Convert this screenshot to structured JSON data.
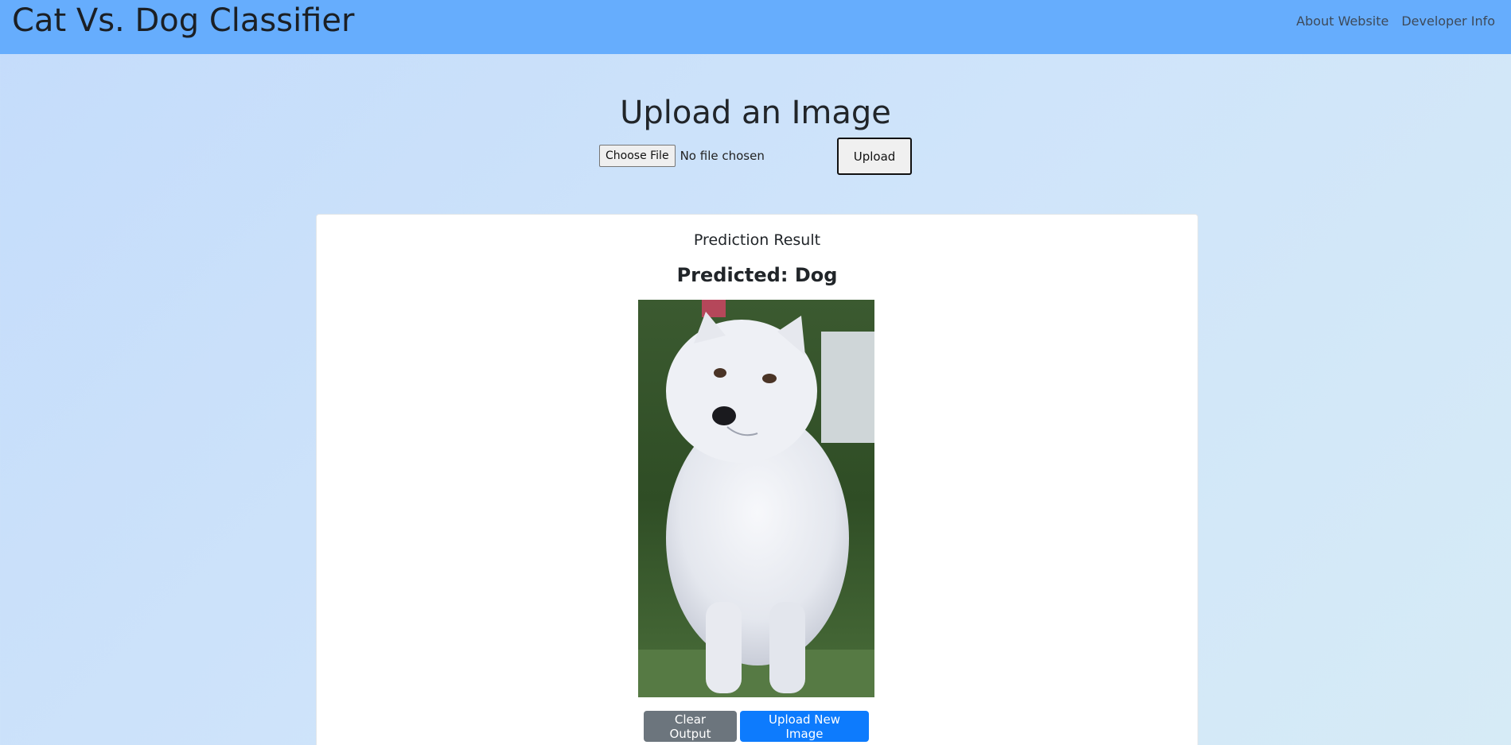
{
  "navbar": {
    "brand": "Cat Vs. Dog Classifier",
    "links": [
      {
        "label": "About Website"
      },
      {
        "label": "Developer Info"
      }
    ]
  },
  "upload": {
    "title": "Upload an Image",
    "choose_file_label": "Choose File",
    "file_status": "No file chosen",
    "upload_label": "Upload"
  },
  "result": {
    "heading": "Prediction Result",
    "prediction": "Predicted: Dog",
    "image_subject": "white-dog-photo",
    "clear_label": "Clear Output",
    "new_image_label": "Upload New Image"
  },
  "colors": {
    "navbar": "#66adfd",
    "primary_button": "#0d7bfd",
    "secondary_button": "#6c757d"
  }
}
